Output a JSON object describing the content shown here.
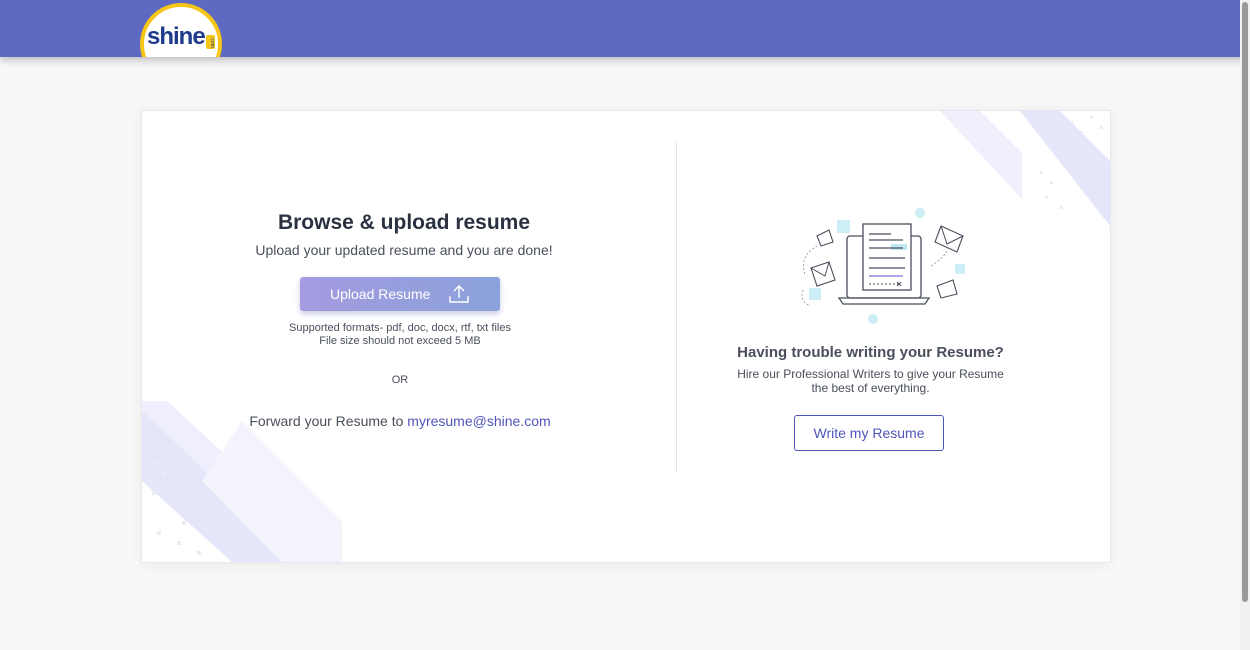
{
  "header": {
    "logo_text": "shine",
    "logo_suffix": ".com"
  },
  "upload": {
    "title": "Browse & upload resume",
    "subtitle": "Upload your updated resume and you are done!",
    "button_label": "Upload Resume",
    "formats_text": "Supported formats- pdf, doc, docx, rtf, txt files",
    "size_text": "File size should not exceed 5 MB",
    "or_text": "OR",
    "forward_text": "Forward your Resume to ",
    "forward_email": "myresume@shine.com"
  },
  "writer": {
    "title": "Having trouble writing your Resume?",
    "text_line1": "Hire our Professional Writers to give your Resume",
    "text_line2": "the best of everything.",
    "button_label": "Write my Resume"
  },
  "colors": {
    "header_bg": "#5e6ac2",
    "accent": "#4f55b8",
    "logo_yellow": "#f5c518"
  }
}
